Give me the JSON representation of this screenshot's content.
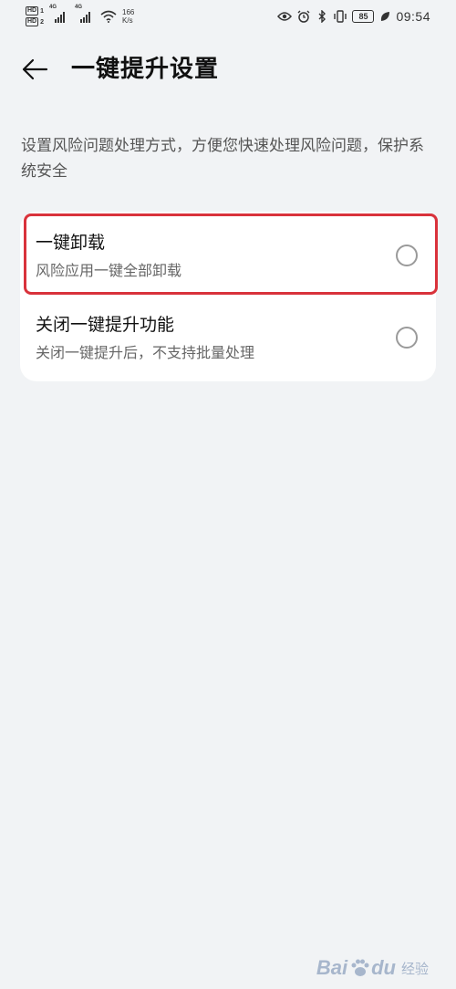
{
  "status_bar": {
    "sim1_label": "HD",
    "sim1_index": "1",
    "sim2_label": "HD",
    "sim2_index": "2",
    "signal1_type": "4G",
    "signal2_type": "4G",
    "net_speed_value": "166",
    "net_speed_unit": "K/s",
    "battery": "85",
    "time": "09:54",
    "icons": [
      "eye-icon",
      "alarm-icon",
      "bluetooth-icon",
      "vibrate-icon",
      "leaf-icon"
    ]
  },
  "header": {
    "title": "一键提升设置",
    "back_icon": "arrow-left-icon"
  },
  "description": "设置风险问题处理方式，方便您快速处理风险问题，保护系统安全",
  "options": [
    {
      "label": "一键卸载",
      "sub": "风险应用一键全部卸载",
      "selected": false
    },
    {
      "label": "关闭一键提升功能",
      "sub": "关闭一键提升后，不支持批量处理",
      "selected": false
    }
  ],
  "colors": {
    "background": "#f1f3f5",
    "card": "#ffffff",
    "highlight": "#d9323b"
  },
  "watermark": {
    "brand": "Bai",
    "brand_suffix": "du",
    "sub": "经验"
  }
}
